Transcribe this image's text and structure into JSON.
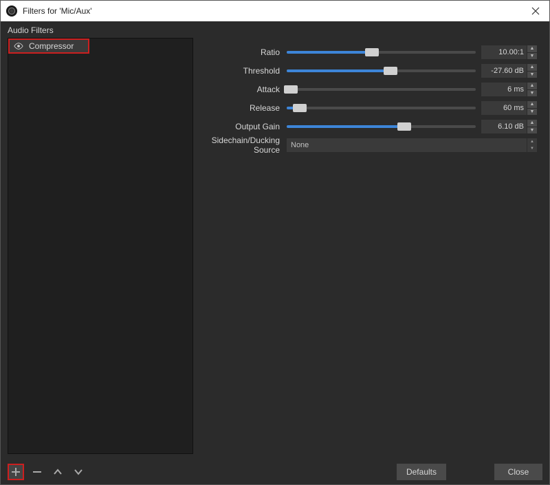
{
  "title": "Filters for 'Mic/Aux'",
  "section_label": "Audio Filters",
  "filters": [
    {
      "name": "Compressor",
      "visible": true
    }
  ],
  "params": {
    "ratio": {
      "label": "Ratio",
      "value": "10.00:1",
      "percent": 45
    },
    "threshold": {
      "label": "Threshold",
      "value": "-27.60 dB",
      "percent": 55
    },
    "attack": {
      "label": "Attack",
      "value": "6 ms",
      "percent": 2
    },
    "release": {
      "label": "Release",
      "value": "60 ms",
      "percent": 7
    },
    "output_gain": {
      "label": "Output Gain",
      "value": "6.10 dB",
      "percent": 62
    }
  },
  "sidechain": {
    "label": "Sidechain/Ducking Source",
    "value": "None"
  },
  "buttons": {
    "defaults": "Defaults",
    "close": "Close"
  }
}
